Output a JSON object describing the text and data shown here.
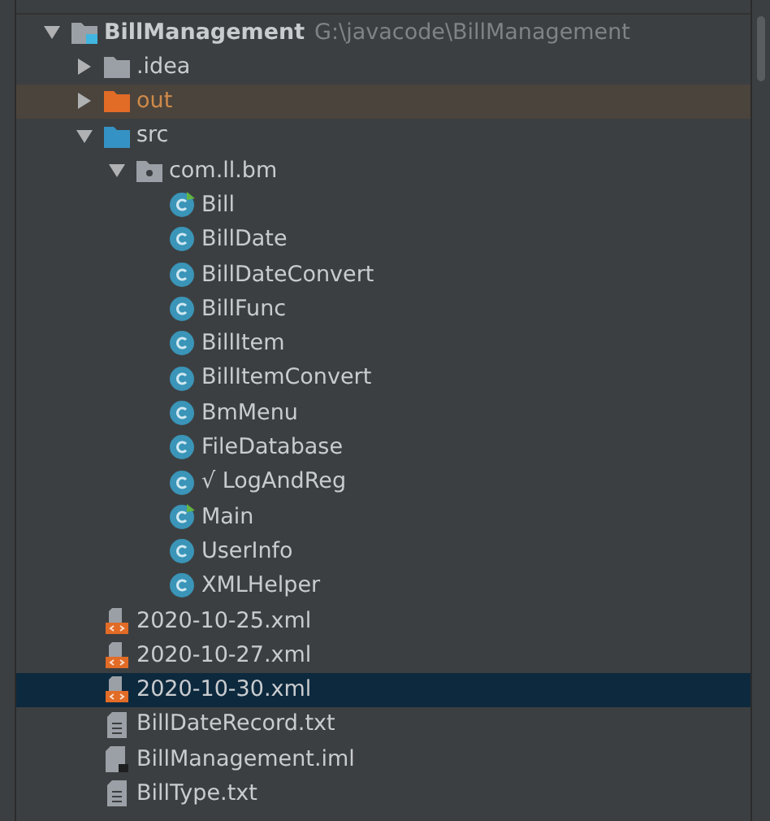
{
  "tree": [
    {
      "label": "BillManagement",
      "path": "G:\\javacode\\BillManagement",
      "kind": "module",
      "expanded": true,
      "selected": false,
      "highlighted": false,
      "children": [
        {
          "label": ".idea",
          "kind": "folder",
          "expanded": false,
          "selected": false,
          "highlighted": false
        },
        {
          "label": "out",
          "kind": "excluded-folder",
          "expanded": false,
          "selected": false,
          "highlighted": true
        },
        {
          "label": "src",
          "kind": "source-folder",
          "expanded": true,
          "selected": false,
          "highlighted": false,
          "children": [
            {
              "label": "com.ll.bm",
              "kind": "package",
              "expanded": true,
              "selected": false,
              "highlighted": false,
              "children": [
                {
                  "label": "Bill",
                  "kind": "main-class",
                  "selected": false,
                  "highlighted": false
                },
                {
                  "label": "BillDate",
                  "kind": "class",
                  "selected": false,
                  "highlighted": false
                },
                {
                  "label": "BillDateConvert",
                  "kind": "class",
                  "selected": false,
                  "highlighted": false
                },
                {
                  "label": "BillFunc",
                  "kind": "class",
                  "selected": false,
                  "highlighted": false
                },
                {
                  "label": "BillItem",
                  "kind": "class",
                  "selected": false,
                  "highlighted": false
                },
                {
                  "label": "BillItemConvert",
                  "kind": "class",
                  "selected": false,
                  "highlighted": false
                },
                {
                  "label": "BmMenu",
                  "kind": "class",
                  "selected": false,
                  "highlighted": false
                },
                {
                  "label": "FileDatabase",
                  "kind": "class",
                  "selected": false,
                  "highlighted": false
                },
                {
                  "label": "√ LogAndReg",
                  "kind": "class",
                  "selected": false,
                  "highlighted": false
                },
                {
                  "label": "Main",
                  "kind": "main-class",
                  "selected": false,
                  "highlighted": false
                },
                {
                  "label": "UserInfo",
                  "kind": "class",
                  "selected": false,
                  "highlighted": false
                },
                {
                  "label": "XMLHelper",
                  "kind": "class",
                  "selected": false,
                  "highlighted": false
                }
              ]
            }
          ]
        },
        {
          "label": "2020-10-25.xml",
          "kind": "xml",
          "selected": false,
          "highlighted": false
        },
        {
          "label": "2020-10-27.xml",
          "kind": "xml",
          "selected": false,
          "highlighted": false
        },
        {
          "label": "2020-10-30.xml",
          "kind": "xml",
          "selected": true,
          "highlighted": false
        },
        {
          "label": "BillDateRecord.txt",
          "kind": "text",
          "selected": false,
          "highlighted": false
        },
        {
          "label": "BillManagement.iml",
          "kind": "iml",
          "selected": false,
          "highlighted": false
        },
        {
          "label": "BillType.txt",
          "kind": "text",
          "selected": false,
          "highlighted": false
        }
      ]
    }
  ]
}
